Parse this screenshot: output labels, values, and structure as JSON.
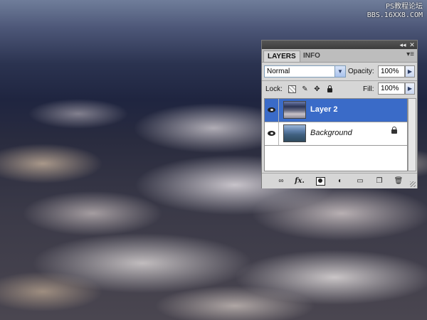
{
  "watermark": {
    "line1": "PS教程论坛",
    "line2": "BBS.16XX8.COM"
  },
  "panel": {
    "collapse_icon": "double-arrow-icon",
    "close_icon": "close-icon",
    "tabs": [
      {
        "label": "LAYERS",
        "active": true
      },
      {
        "label": "INFO",
        "active": false
      }
    ],
    "menu_icon": "panel-menu-icon",
    "blend_mode": "Normal",
    "opacity_label": "Opacity:",
    "opacity_value": "100%",
    "lock_label": "Lock:",
    "fill_label": "Fill:",
    "fill_value": "100%",
    "lock_icons": [
      "lock-transparent-icon",
      "lock-brush-icon",
      "lock-move-icon",
      "lock-all-icon"
    ],
    "layers": [
      {
        "name": "Layer 2",
        "selected": true,
        "visible": true,
        "locked": false
      },
      {
        "name": "Background",
        "selected": false,
        "visible": true,
        "locked": true
      }
    ],
    "bottom_icons": [
      "link-icon",
      "fx-icon",
      "mask-icon",
      "adjustment-icon",
      "group-folder-icon",
      "new-layer-icon",
      "trash-icon"
    ],
    "fx_glyph": "fx."
  },
  "colors": {
    "selection": "#3a6bc8",
    "panel_bg": "#d6d6d6"
  }
}
